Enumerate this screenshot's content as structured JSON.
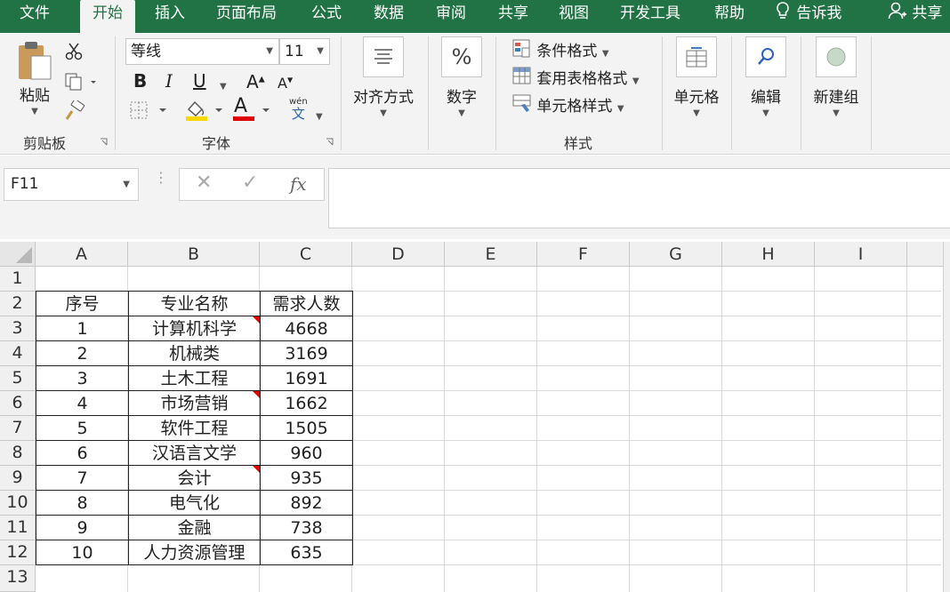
{
  "tabs": {
    "file": "文件",
    "home": "开始",
    "insert": "插入",
    "layout": "页面布局",
    "formulas": "公式",
    "data": "数据",
    "review": "审阅",
    "share_tab": "共享",
    "view": "视图",
    "developer": "开发工具",
    "help": "帮助",
    "tell_me": "告诉我",
    "share": "共享"
  },
  "ribbon": {
    "clipboard": {
      "paste": "粘贴",
      "label": "剪贴板"
    },
    "font": {
      "name": "等线",
      "size": "11",
      "bold": "B",
      "italic": "I",
      "underline": "U",
      "grow": "A",
      "shrink": "A",
      "phonetic_top": "wén",
      "phonetic_bottom": "文",
      "font_color_letter": "A",
      "label": "字体",
      "font_color": "#e00000",
      "highlight_color": "#ffd800"
    },
    "alignment": {
      "label": "对齐方式"
    },
    "number": {
      "symbol": "%",
      "label": "数字"
    },
    "styles": {
      "conditional": "条件格式",
      "table": "套用表格格式",
      "cell_styles": "单元格样式",
      "label": "样式"
    },
    "cells": {
      "label": "单元格"
    },
    "editing": {
      "label": "编辑"
    },
    "newgroup": {
      "label": "新建组"
    }
  },
  "formula_bar": {
    "name_box": "F11",
    "cancel": "✕",
    "enter": "✓",
    "fx": "fx",
    "content": ""
  },
  "columns": [
    "A",
    "B",
    "C",
    "D",
    "E",
    "F",
    "G",
    "H",
    "I"
  ],
  "rows": [
    "1",
    "2",
    "3",
    "4",
    "5",
    "6",
    "7",
    "8",
    "9",
    "10",
    "11",
    "12",
    "13"
  ],
  "table": {
    "header": [
      "序号",
      "专业名称",
      "需求人数"
    ],
    "rows": [
      [
        "1",
        "计算机科学",
        "4668"
      ],
      [
        "2",
        "机械类",
        "3169"
      ],
      [
        "3",
        "土木工程",
        "1691"
      ],
      [
        "4",
        "市场营销",
        "1662"
      ],
      [
        "5",
        "软件工程",
        "1505"
      ],
      [
        "6",
        "汉语言文学",
        "960"
      ],
      [
        "7",
        "会计",
        "935"
      ],
      [
        "8",
        "电气化",
        "892"
      ],
      [
        "9",
        "金融",
        "738"
      ],
      [
        "10",
        "人力资源管理",
        "635"
      ]
    ]
  },
  "colors": {
    "accent": "#217346",
    "comment_marker": "#e00000"
  }
}
